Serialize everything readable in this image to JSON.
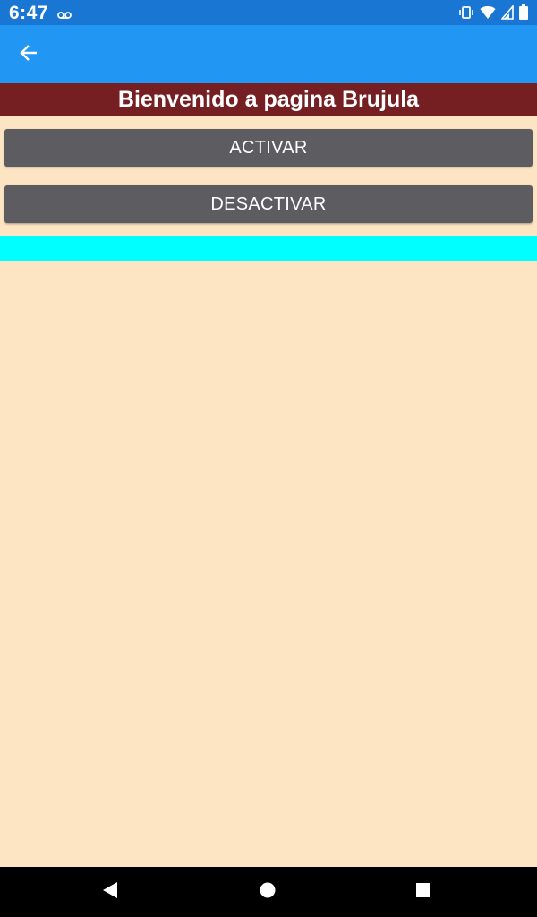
{
  "status_bar": {
    "time": "6:47",
    "icons": [
      "voicemail-icon",
      "vibrate-icon",
      "wifi-icon",
      "signal-icon",
      "battery-icon"
    ],
    "background": "#1976D2"
  },
  "app_bar": {
    "back_icon": "arrow-left-icon",
    "background": "#2196F3"
  },
  "page": {
    "title": "Bienvenido a pagina Brujula",
    "title_background": "#761F22",
    "background": "#FDE4C3"
  },
  "buttons": {
    "activar_label": "ACTIVAR",
    "desactivar_label": "DESACTIVAR",
    "color": "#5D5C60"
  },
  "indicator": {
    "color": "#00FFFF"
  },
  "nav_bar": {
    "icons": [
      "nav-back-icon",
      "nav-home-icon",
      "nav-recents-icon"
    ]
  }
}
